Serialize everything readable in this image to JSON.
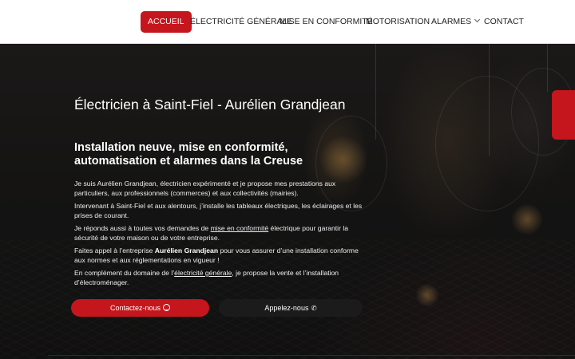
{
  "nav": {
    "items": [
      {
        "label": "ACCUEIL",
        "active": true
      },
      {
        "label": "ÉLECTRICITÉ GÉNÉRALE"
      },
      {
        "label": "MISE EN CONFORMITÉ"
      },
      {
        "label": "MOTORISATION"
      },
      {
        "label": "ALARMES",
        "has_dropdown": true,
        "icon": "chevron-down-icon"
      },
      {
        "label": "CONTACT"
      }
    ]
  },
  "hero": {
    "title": "Électricien à Saint-Fiel - Aurélien Grandjean",
    "subtitle": "Installation neuve, mise en conformité, automatisation et alarmes dans la Creuse",
    "paragraphs": {
      "p1": "Je suis Aurélien Grandjean, électricien expérimenté et je propose mes prestations aux particuliers, aux professionnels (commerces) et aux collectivités (mairies).",
      "p2": "Intervenant à Saint-Fiel et aux alentours, j’installe les tableaux électriques, les éclairages et les prises de courant.",
      "p3": {
        "before": "Je réponds aussi à toutes vos demandes de ",
        "link": "mise en conformité",
        "after": " électrique pour garantir la sécurité de votre maison ou de votre entreprise."
      },
      "p4": {
        "before": "Faites appel à l’entreprise ",
        "bold": "Aurélien Grandjean",
        "after": " pour vous assurer d’une installation conforme aux normes et aux réglementations en vigueur !"
      },
      "p5": {
        "before": "En complément du domaine de l’",
        "link": "électricité générale",
        "after": ", je propose la vente et l’installation d’électroménager."
      }
    }
  },
  "buttons": {
    "contact": {
      "label": "Contactez-nous",
      "icon": "smile-icon"
    },
    "call": {
      "label": "Appelez-nous",
      "icon": "phone-icon"
    }
  },
  "colors": {
    "accent": "#c4161c",
    "header_bg": "#ffffff",
    "hero_bg": "#1c1b1a",
    "dark_button": "#1b1b1b"
  }
}
